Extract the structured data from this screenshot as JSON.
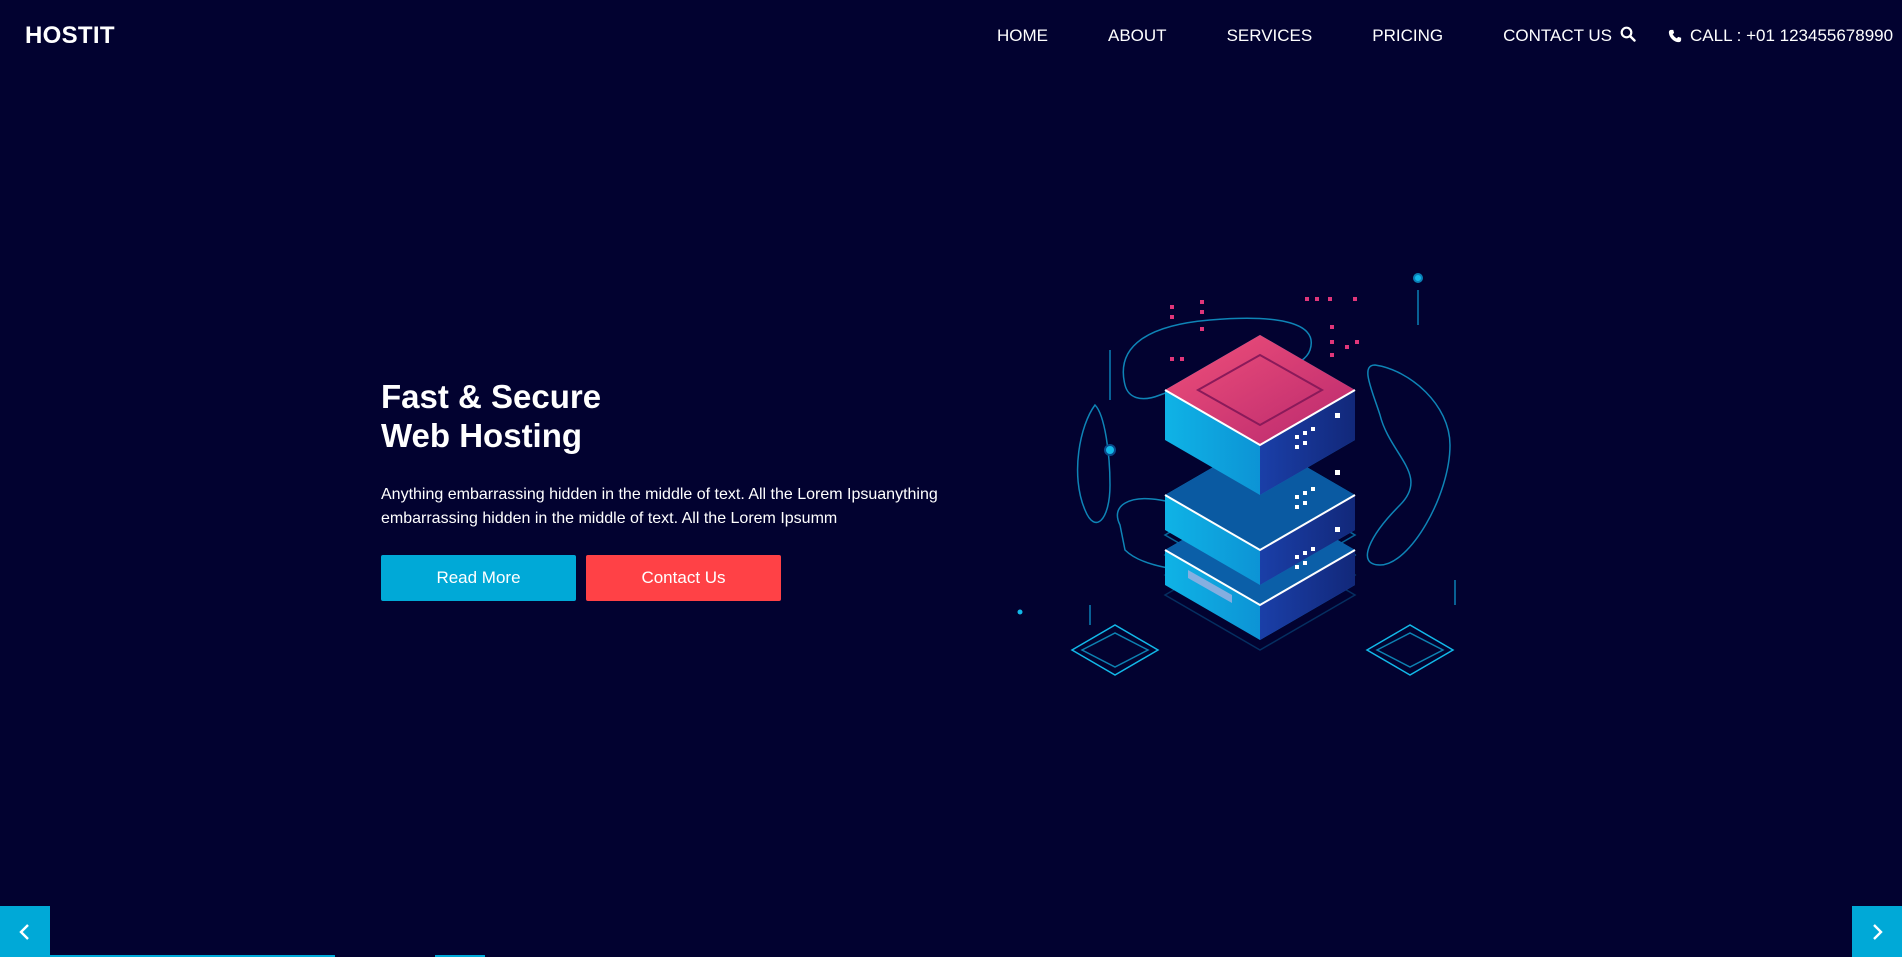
{
  "brand": {
    "logo_text": "HOSTIT"
  },
  "nav": {
    "items": [
      {
        "label": "HOME"
      },
      {
        "label": "ABOUT"
      },
      {
        "label": "SERVICES"
      },
      {
        "label": "PRICING"
      },
      {
        "label": "CONTACT US"
      }
    ],
    "search_icon": "search-icon",
    "call": {
      "icon": "phone-icon",
      "label": "CALL : +01 123455678990"
    }
  },
  "hero": {
    "title_line1": "Fast & Secure",
    "title_line2": "Web Hosting",
    "description": "Anything embarrassing hidden in the middle of text. All the Lorem Ipsuanything embarrassing hidden in the middle of text. All the Lorem Ipsumm",
    "read_more_label": "Read More",
    "contact_label": "Contact Us"
  },
  "slider": {
    "prev_icon": "chevron-left-icon",
    "next_icon": "chevron-right-icon"
  },
  "colors": {
    "background": "#020230",
    "accent": "#00a9d7",
    "danger": "#ff4146",
    "server_top": "#e0406e"
  }
}
